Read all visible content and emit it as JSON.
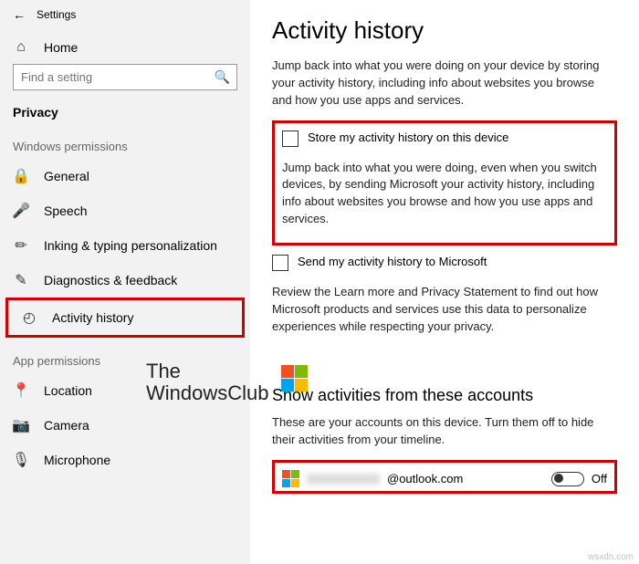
{
  "app": {
    "title": "Settings"
  },
  "sidebar": {
    "home": "Home",
    "search_placeholder": "Find a setting",
    "category": "Privacy",
    "group_permissions": "Windows permissions",
    "items": [
      {
        "label": "General"
      },
      {
        "label": "Speech"
      },
      {
        "label": "Inking & typing personalization"
      },
      {
        "label": "Diagnostics & feedback"
      },
      {
        "label": "Activity history"
      }
    ],
    "group_app": "App permissions",
    "app_items": [
      {
        "label": "Location"
      },
      {
        "label": "Camera"
      },
      {
        "label": "Microphone"
      }
    ]
  },
  "main": {
    "title": "Activity history",
    "intro": "Jump back into what you were doing on your device by storing your activity history, including info about websites you browse and how you use apps and services.",
    "check_store": "Store my activity history on this device",
    "sync_text": "Jump back into what you were doing, even when you switch devices, by sending Microsoft your activity history, including info about websites you browse and how you use apps and services.",
    "check_send": "Send my activity history to Microsoft",
    "review_text": "Review the Learn more and Privacy Statement to find out how Microsoft products and services use this data to personalize experiences while respecting your privacy.",
    "accounts_title": "Show activities from these accounts",
    "accounts_desc": "These are your accounts on this device. Turn them off to hide their activities from your timeline.",
    "account_email_suffix": "@outlook.com",
    "toggle_state": "Off"
  },
  "watermark": {
    "line1": "The",
    "line2": "WindowsClub"
  },
  "footer": "wsxdn.com"
}
